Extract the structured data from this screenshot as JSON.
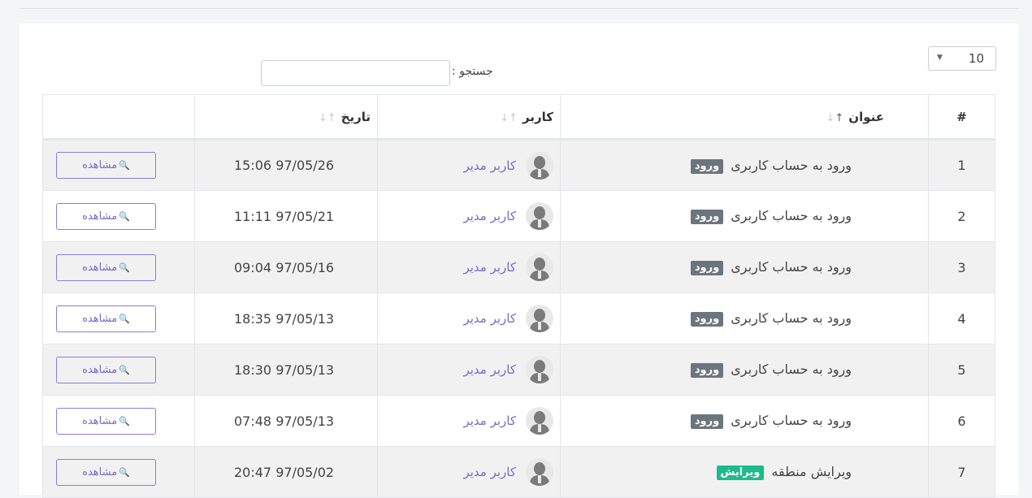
{
  "length_select": {
    "value": "10"
  },
  "search": {
    "label": "جستجو :",
    "placeholder": ""
  },
  "columns": {
    "num": "#",
    "title": "عنوان",
    "user": "کاربر",
    "date": "تاریخ"
  },
  "rows": [
    {
      "num": "1",
      "title": "ورود به حساب کاربری",
      "badge": "ورود",
      "badge_type": "login",
      "user": "کاربر مدیر",
      "date": "15:06 97/05/26",
      "action": "مشاهده"
    },
    {
      "num": "2",
      "title": "ورود به حساب کاربری",
      "badge": "ورود",
      "badge_type": "login",
      "user": "کاربر مدیر",
      "date": "11:11 97/05/21",
      "action": "مشاهده"
    },
    {
      "num": "3",
      "title": "ورود به حساب کاربری",
      "badge": "ورود",
      "badge_type": "login",
      "user": "کاربر مدیر",
      "date": "09:04 97/05/16",
      "action": "مشاهده"
    },
    {
      "num": "4",
      "title": "ورود به حساب کاربری",
      "badge": "ورود",
      "badge_type": "login",
      "user": "کاربر مدیر",
      "date": "18:35 97/05/13",
      "action": "مشاهده"
    },
    {
      "num": "5",
      "title": "ورود به حساب کاربری",
      "badge": "ورود",
      "badge_type": "login",
      "user": "کاربر مدیر",
      "date": "18:30 97/05/13",
      "action": "مشاهده"
    },
    {
      "num": "6",
      "title": "ورود به حساب کاربری",
      "badge": "ورود",
      "badge_type": "login",
      "user": "کاربر مدیر",
      "date": "07:48 97/05/13",
      "action": "مشاهده"
    },
    {
      "num": "7",
      "title": "ویرایش منطقه",
      "badge": "ویرایش",
      "badge_type": "edit",
      "user": "کاربر مدیر",
      "date": "20:47 97/05/02",
      "action": "مشاهده"
    }
  ],
  "colors": {
    "login_badge": "#6c757d",
    "edit_badge": "#1cbb8c",
    "accent": "#7b68c9"
  }
}
